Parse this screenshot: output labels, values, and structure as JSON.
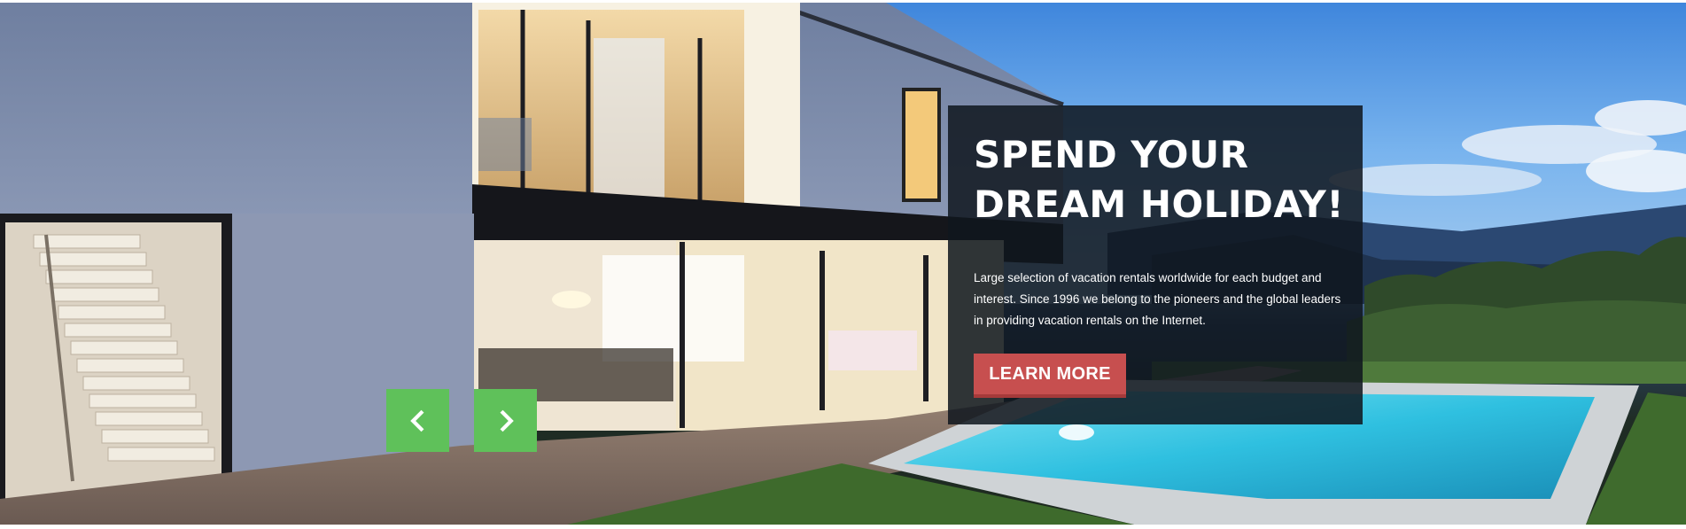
{
  "hero": {
    "headline_line1": "SPEND YOUR",
    "headline_line2": "DREAM HOLIDAY!",
    "description": "Large selection of vacation rentals worldwide for each budget and interest. Since 1996 we belong to the pioneers and the global leaders in providing vacation rentals on the Internet.",
    "cta_label": "LEARN MORE",
    "background_image": "modern villa at dusk with lit interior and swimming pool",
    "colors": {
      "overlay": "#0f161e",
      "cta": "#c74f4f",
      "arrows": "#5fc15a"
    }
  },
  "slider": {
    "prev_icon": "chevron-left-icon",
    "next_icon": "chevron-right-icon"
  }
}
